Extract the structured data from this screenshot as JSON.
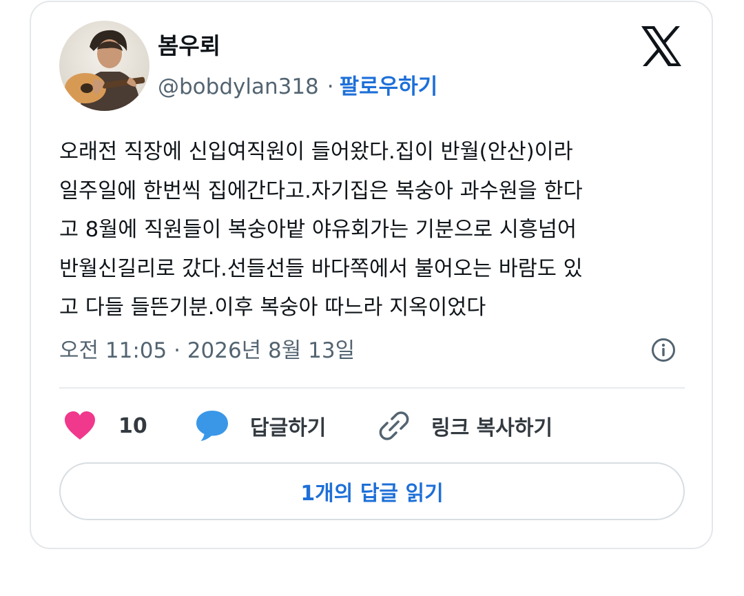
{
  "user": {
    "display_name": "봄우뢰",
    "handle": "@bobdylan318",
    "separator": "·",
    "follow_label": "팔로우하기",
    "avatar_icon": "guitar-player-avatar"
  },
  "brand": {
    "logo_icon": "x-logo-icon"
  },
  "tweet": {
    "lines": [
      "오래전 직장에 신입여직원이 들어왔다.집이 반월(안산)이라",
      "일주일에 한번씩 집에간다고.자기집은 복숭아 과수원을 한다",
      "고 8월에 직원들이 복숭아밭 야유회가는 기분으로 시흥넘어",
      "반월신길리로 갔다.선들선들 바다쪽에서 불어오는 바람도 있",
      "고 다들 들뜬기분.이후 복숭아 따느라 지옥이었다"
    ],
    "timestamp": "오전 11:05 · 2026년 8월 13일",
    "info_icon": "info-icon"
  },
  "actions": {
    "like_count": "10",
    "reply_label": "답글하기",
    "copy_link_label": "링크 복사하기"
  },
  "replies_button_label": "1개의 답글 읽기",
  "colors": {
    "accent_blue": "#1d6fd8",
    "heart": "#f0388c",
    "reply_bubble": "#3a97e8",
    "text_primary": "#0f1419",
    "text_secondary": "#536471"
  }
}
